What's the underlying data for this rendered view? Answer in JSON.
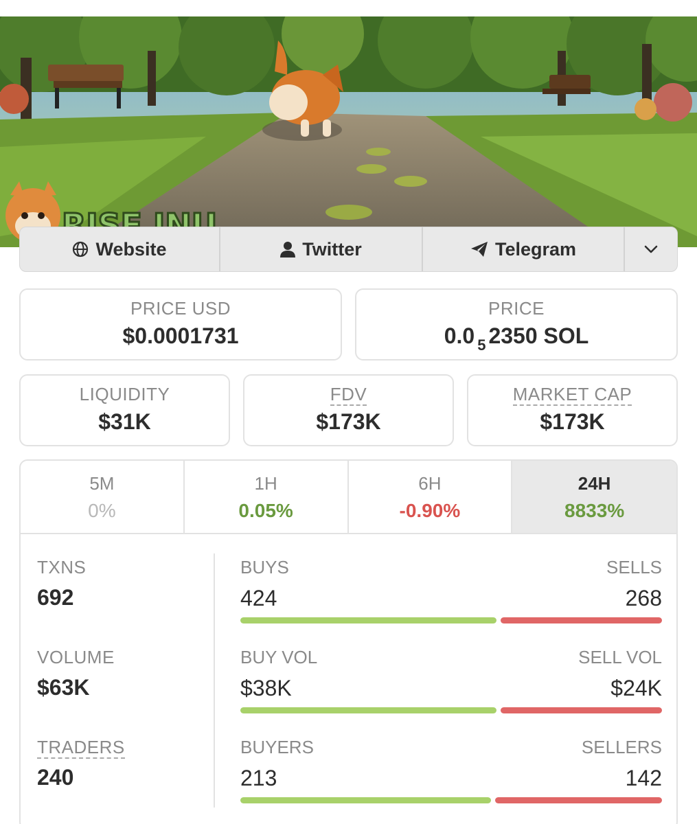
{
  "banner": {
    "logo_text": "RISE INU"
  },
  "links": {
    "website": "Website",
    "twitter": "Twitter",
    "telegram": "Telegram",
    "more_icon": "chevron-down-icon"
  },
  "price_usd": {
    "label": "PRICE USD",
    "value": "$0.0001731"
  },
  "price": {
    "label": "PRICE",
    "prefix": "0.0",
    "zeros": "5",
    "rest": "2350 SOL"
  },
  "liquidity": {
    "label": "LIQUIDITY",
    "value": "$31K"
  },
  "fdv": {
    "label": "FDV",
    "value": "$173K"
  },
  "market_cap": {
    "label": "MARKET CAP",
    "value": "$173K"
  },
  "timeframes": [
    {
      "label": "5M",
      "change": "0%"
    },
    {
      "label": "1H",
      "change": "0.05%"
    },
    {
      "label": "6H",
      "change": "-0.90%"
    },
    {
      "label": "24H",
      "change": "8833%"
    }
  ],
  "active_timeframe": "24H",
  "stats": {
    "txns": {
      "label": "TXNS",
      "value": "692"
    },
    "volume": {
      "label": "VOLUME",
      "value": "$63K"
    },
    "traders": {
      "label": "TRADERS",
      "value": "240"
    }
  },
  "splits": {
    "buys": {
      "label": "BUYS",
      "value": "424"
    },
    "sells": {
      "label": "SELLS",
      "value": "268"
    },
    "buy_vol": {
      "label": "BUY VOL",
      "value": "$38K"
    },
    "sell_vol": {
      "label": "SELL VOL",
      "value": "$24K"
    },
    "buyers": {
      "label": "BUYERS",
      "value": "213"
    },
    "sellers": {
      "label": "SELLERS",
      "value": "142"
    }
  },
  "colors": {
    "positive": "#6a9a3f",
    "negative": "#d9534f",
    "buy_bar": "#a8d16a",
    "sell_bar": "#e06666"
  }
}
